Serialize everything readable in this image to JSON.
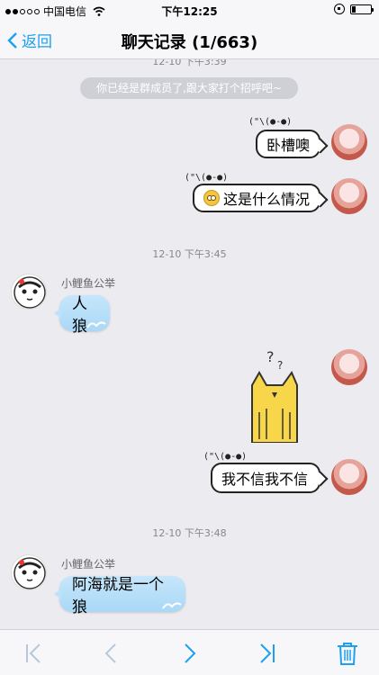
{
  "status": {
    "carrier": "中国电信",
    "time": "下午12:25"
  },
  "nav": {
    "back_label": "返回",
    "title": "聊天记录 (1/663)"
  },
  "chat": {
    "partial_timestamp": "12-10 下午3:39",
    "system_message": "你已经是群成员了,跟大家打个招呼吧~",
    "doodle_face": "(\"\\(●-●)",
    "messages": [
      {
        "kind": "out",
        "text": "卧槽噢"
      },
      {
        "kind": "out",
        "text": "这是什么情况",
        "emoji": "flushed-face-icon"
      },
      {
        "kind": "timestamp",
        "text": "12-10 下午3:45"
      },
      {
        "kind": "in",
        "sender": "小鲤鱼公举",
        "text": "人狼"
      },
      {
        "kind": "out-sticker",
        "sticker": "yellow-cat-sticker"
      },
      {
        "kind": "out",
        "text": "我不信我不信"
      },
      {
        "kind": "timestamp",
        "text": "12-10 下午3:48"
      },
      {
        "kind": "in",
        "sender": "小鲤鱼公举",
        "text": "阿海就是一个狼"
      }
    ]
  },
  "toolbar": {
    "first": "first-page-icon",
    "prev": "prev-page-icon",
    "next": "next-page-icon",
    "last": "last-page-icon",
    "delete": "trash-icon"
  },
  "colors": {
    "accent": "#1aa1f0",
    "background": "#ebebf0",
    "incoming_bubble": "#b6def8"
  }
}
